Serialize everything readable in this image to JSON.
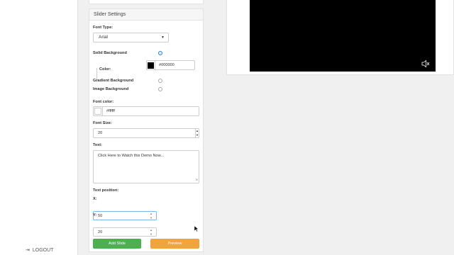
{
  "sidebar": {
    "logout_label": "LOGOUT"
  },
  "slider_settings": {
    "title": "Slider Settings",
    "font_type_label": "Font Type:",
    "font_type_value": "Arial",
    "solid_background_label": "Solid Background",
    "solid_background_selected": true,
    "color_label": "Color:",
    "background_color_value": "#000000",
    "gradient_background_label": "Gradient Background",
    "image_background_label": "Image Background",
    "font_color_label": "Font color:",
    "font_color_value": "#ffffff",
    "font_size_label": "Font Size:",
    "font_size_value": "20",
    "text_label": "Text:",
    "text_value": "Click Here to Watch this Demo Now...",
    "text_position_label": "Text position:",
    "x_label": "X:",
    "x_value": "50",
    "y_label": "Y:",
    "y_value": "20",
    "add_slide_label": "Add Slide",
    "preview_label": "Preview"
  },
  "colors": {
    "accent": "#2b7de9",
    "add_button": "#4caf50",
    "preview_button": "#f0a43c",
    "video_background": "#000000"
  },
  "icons": {
    "logout": "logout-icon",
    "mute": "speaker-muted-icon",
    "dropdown": "caret-down-icon"
  }
}
